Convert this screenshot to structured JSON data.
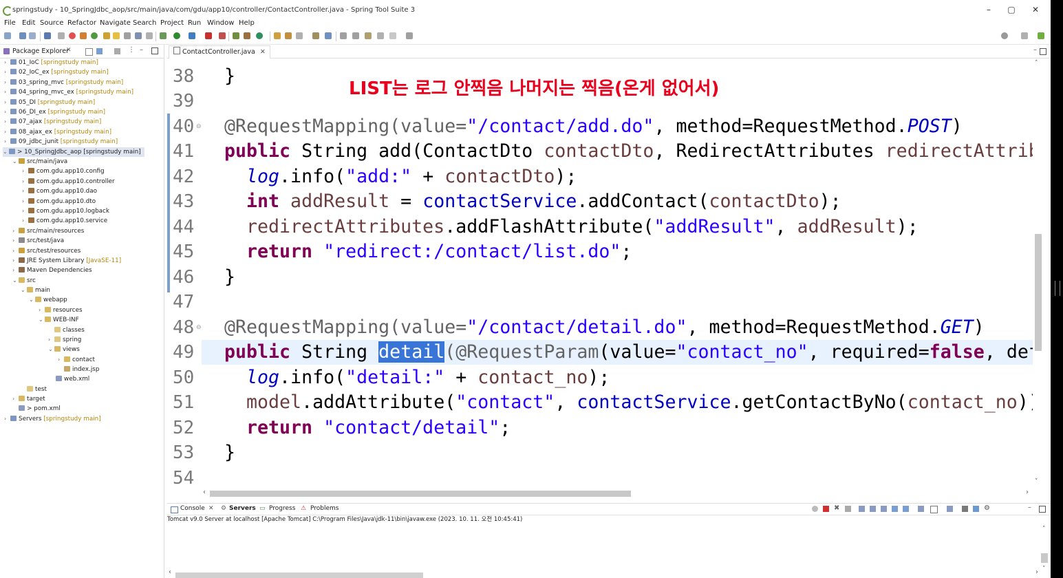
{
  "window": {
    "title": "springstudy - 10_SpringJdbc_aop/src/main/java/com/gdu/app10/controller/ContactController.java - Spring Tool Suite 3",
    "controls": [
      "–",
      "▢",
      "✕"
    ]
  },
  "menu": [
    "File",
    "Edit",
    "Source",
    "Refactor",
    "Navigate",
    "Search",
    "Project",
    "Run",
    "Window",
    "Help"
  ],
  "package_explorer": {
    "title": "Package Explorer",
    "tree": [
      {
        "label": "01_IoC",
        "deco": "[springstudy main]"
      },
      {
        "label": "02_IoC_ex",
        "deco": "[springstudy main]"
      },
      {
        "label": "03_spring_mvc",
        "deco": "[springstudy main]"
      },
      {
        "label": "04_spring_mvc_ex",
        "deco": "[springstudy main]"
      },
      {
        "label": "05_DI",
        "deco": "[springstudy main]"
      },
      {
        "label": "06_DI_ex",
        "deco": "[springstudy main]"
      },
      {
        "label": "07_ajax",
        "deco": "[springstudy main]"
      },
      {
        "label": "08_ajax_ex",
        "deco": "[springstudy main]"
      },
      {
        "label": "09_jdbc_junit",
        "deco": "[springstudy main]"
      },
      {
        "label": "> 10_SpringJdbc_aop [springstudy main]",
        "deco": ""
      },
      {
        "label": "src/main/java",
        "deco": ""
      },
      {
        "label": "com.gdu.app10.config",
        "deco": ""
      },
      {
        "label": "com.gdu.app10.controller",
        "deco": ""
      },
      {
        "label": "com.gdu.app10.dao",
        "deco": ""
      },
      {
        "label": "com.gdu.app10.dto",
        "deco": ""
      },
      {
        "label": "com.gdu.app10.logback",
        "deco": ""
      },
      {
        "label": "com.gdu.app10.service",
        "deco": ""
      },
      {
        "label": "src/main/resources",
        "deco": ""
      },
      {
        "label": "src/test/java",
        "deco": ""
      },
      {
        "label": "src/test/resources",
        "deco": ""
      },
      {
        "label": "JRE System Library",
        "deco": "[JavaSE-11]"
      },
      {
        "label": "Maven Dependencies",
        "deco": ""
      },
      {
        "label": "src",
        "deco": ""
      },
      {
        "label": "main",
        "deco": ""
      },
      {
        "label": "webapp",
        "deco": ""
      },
      {
        "label": "resources",
        "deco": ""
      },
      {
        "label": "WEB-INF",
        "deco": ""
      },
      {
        "label": "classes",
        "deco": ""
      },
      {
        "label": "spring",
        "deco": ""
      },
      {
        "label": "views",
        "deco": ""
      },
      {
        "label": "contact",
        "deco": ""
      },
      {
        "label": "index.jsp",
        "deco": ""
      },
      {
        "label": "web.xml",
        "deco": ""
      },
      {
        "label": "test",
        "deco": ""
      },
      {
        "label": "target",
        "deco": ""
      },
      {
        "label": "> pom.xml",
        "deco": ""
      },
      {
        "label": "Servers",
        "deco": "[springstudy main]"
      }
    ]
  },
  "editor": {
    "tab": "ContactController.java",
    "overlay_note": "LIST는 로그 안찍음 나머지는 찍음(온게 없어서)",
    "line_numbers": [
      "38",
      "39",
      "40",
      "41",
      "42",
      "43",
      "44",
      "45",
      "46",
      "47",
      "48",
      "49",
      "50",
      "51",
      "52",
      "53",
      "54"
    ],
    "code": {
      "l38": "}",
      "l40_ann": "@RequestMapping(value=",
      "l40_str": "\"/contact/add.do\"",
      "l40_mid": ", method=RequestMethod.",
      "l40_const": "POST",
      "l40_end": ")",
      "l41_kw": "public",
      "l41_rest": " String add(ContactDto ",
      "l41_var1": "contactDto",
      "l41_mid": ", RedirectAttributes ",
      "l41_var2": "redirectAttrib",
      "l42_log": "log",
      "l42_mid": ".info(",
      "l42_str": "\"add:\"",
      "l42_plus": " + ",
      "l42_var": "contactDto",
      "l42_end": ");",
      "l43_kw": "int",
      "l43_var": " addResult",
      "l43_eq": " = ",
      "l43_fld": "contactService",
      "l43_call": ".addContact(",
      "l43_var2": "contactDto",
      "l43_end": ");",
      "l44_var": "redirectAttributes",
      "l44_call": ".addFlashAttribute(",
      "l44_str": "\"addResult\"",
      "l44_comma": ", ",
      "l44_var2": "addResult",
      "l44_end": ");",
      "l45_kw": "return",
      "l45_str": " \"redirect:/contact/list.do\"",
      "l45_end": ";",
      "l46": "}",
      "l48_ann": "@RequestMapping(value=",
      "l48_str": "\"/contact/detail.do\"",
      "l48_mid": ", method=RequestMethod.",
      "l48_const": "GET",
      "l48_end": ")",
      "l49_kw": "public",
      "l49_rest": " String ",
      "l49_sel": "detail",
      "l49_ann": "(@RequestParam",
      "l49_p": "(value=",
      "l49_str": "\"contact_no\"",
      "l49_mid": ", required=",
      "l49_kw2": "false",
      "l49_end": ", def",
      "l50_log": "log",
      "l50_mid": ".info(",
      "l50_str": "\"detail:\"",
      "l50_plus": " + ",
      "l50_var": "contact_no",
      "l50_end": ");",
      "l51_var": "model",
      "l51_call": ".addAttribute(",
      "l51_str": "\"contact\"",
      "l51_comma": ", ",
      "l51_fld": "contactService",
      "l51_call2": ".getContactByNo(",
      "l51_var2": "contact_no",
      "l51_end": "))",
      "l52_kw": "return",
      "l52_str": " \"contact/detail\"",
      "l52_end": ";",
      "l53": "}"
    }
  },
  "console": {
    "tabs": [
      "Console",
      "Servers",
      "Progress",
      "Problems"
    ],
    "description": "Tomcat v9.0 Server at localhost [Apache Tomcat] C:\\Program Files\\Java\\jdk-11\\bin\\javaw.exe  (2023. 10. 11. 오전 10:45:41)"
  },
  "colors": {
    "keyword": "#7f0055",
    "string": "#2a00ff",
    "field": "#0000c0",
    "local_var": "#6a3e3e",
    "annotation": "#646464",
    "overlay_note": "#e8001c",
    "selection": "#3875d7"
  }
}
